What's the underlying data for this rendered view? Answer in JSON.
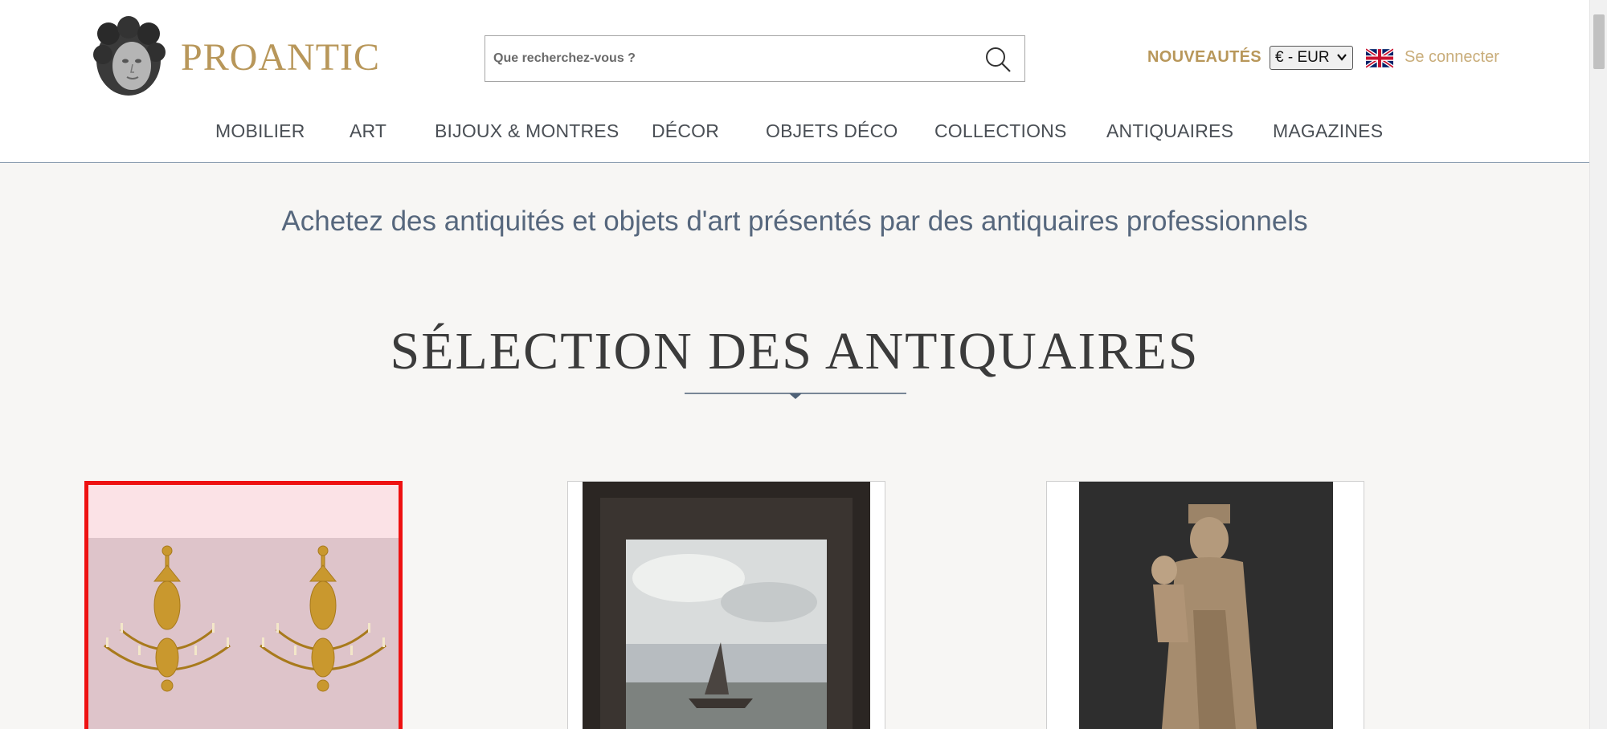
{
  "header": {
    "logo_text": "PROANTIC",
    "search": {
      "placeholder": "Que recherchez-vous ?",
      "value": ""
    },
    "nouveautes_label": "NOUVEAUTÉS",
    "currency_selected": "€ - EUR",
    "language_flag": "uk-flag-icon",
    "login_label": "Se connecter",
    "accent_color": "#b8975a"
  },
  "nav": {
    "items": [
      {
        "label": "MOBILIER"
      },
      {
        "label": "ART"
      },
      {
        "label": "BIJOUX & MONTRES"
      },
      {
        "label": "DÉCOR"
      },
      {
        "label": "OBJETS DÉCO"
      },
      {
        "label": "COLLECTIONS"
      },
      {
        "label": "ANTIQUAIRES"
      },
      {
        "label": "MAGAZINES"
      }
    ]
  },
  "main": {
    "tagline": "Achetez des antiquités et objets d'art présentés par des antiquaires professionnels",
    "section_title": "SÉLECTION DES ANTIQUAIRES",
    "cards": [
      {
        "image": "pair-of-gilt-chandeliers",
        "selected": true
      },
      {
        "image": "framed-seascape-painting",
        "selected": false
      },
      {
        "image": "virgin-and-child-statue",
        "selected": false
      }
    ]
  }
}
